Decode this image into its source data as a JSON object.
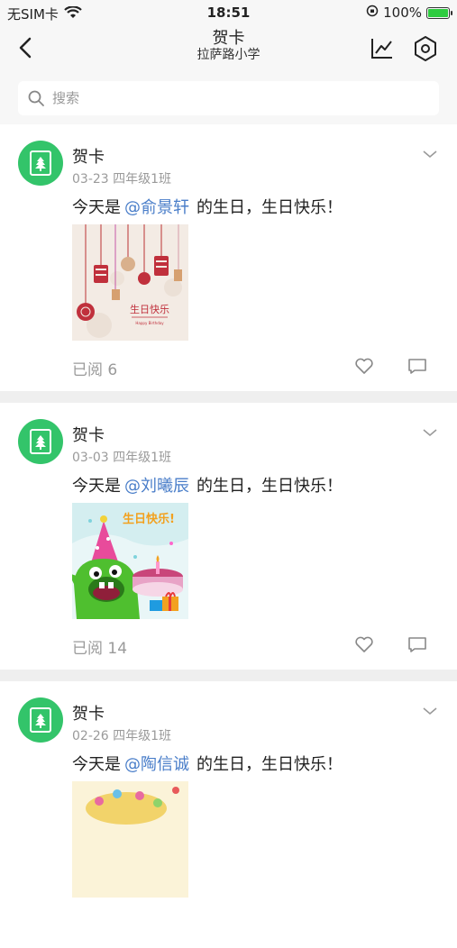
{
  "status_bar": {
    "carrier": "无SIM卡",
    "time": "18:51",
    "battery": "100%"
  },
  "nav": {
    "title": "贺卡",
    "subtitle": "拉萨路小学"
  },
  "search": {
    "placeholder": "搜索"
  },
  "cards": [
    {
      "sender": "贺卡",
      "date": "03-23",
      "class": "四年级1班",
      "prefix": "今天是",
      "mention": "@俞景轩",
      "suffix": "的生日，生日快乐！",
      "read": "已阅 6",
      "card_text": "生日快乐",
      "card_subtext": "Happy Birthday"
    },
    {
      "sender": "贺卡",
      "date": "03-03",
      "class": "四年级1班",
      "prefix": "今天是",
      "mention": "@刘曦辰",
      "suffix": "的生日，生日快乐！",
      "read": "已阅 14",
      "card_text": "生日快乐!"
    },
    {
      "sender": "贺卡",
      "date": "02-26",
      "class": "四年级1班",
      "prefix": "今天是",
      "mention": "@陶信诚",
      "suffix": "的生日，生日快乐！",
      "read": ""
    }
  ]
}
